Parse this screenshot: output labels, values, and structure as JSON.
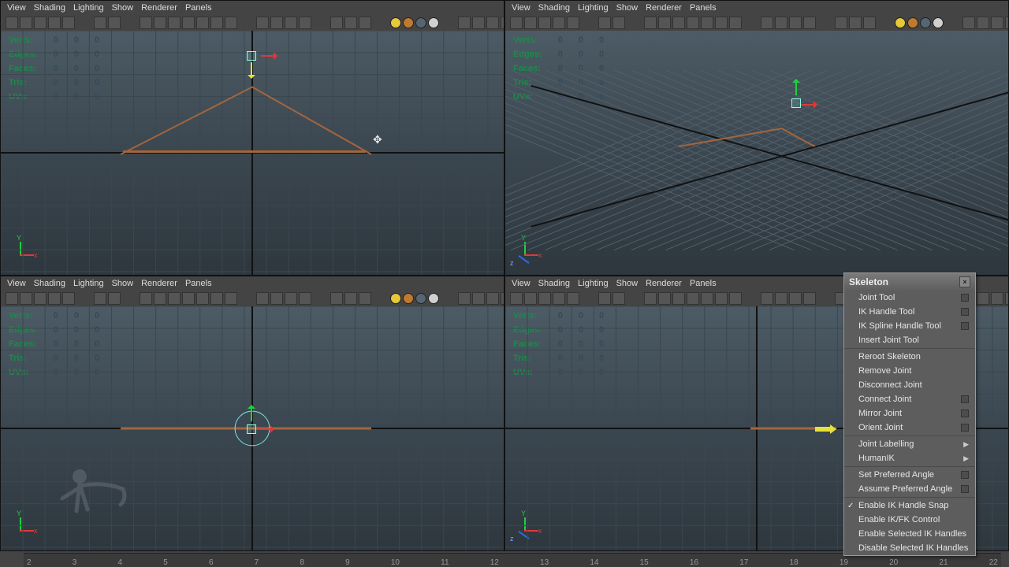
{
  "menus": [
    "View",
    "Shading",
    "Lighting",
    "Show",
    "Renderer",
    "Panels"
  ],
  "stats": {
    "labels": [
      "Verts:",
      "Edges:",
      "Faces:",
      "Tris:",
      "UVs:"
    ],
    "cols": [
      "0",
      "0",
      "0"
    ]
  },
  "skeleton": {
    "title": "Skeleton",
    "items": [
      {
        "label": "Joint Tool",
        "opt": true
      },
      {
        "label": "IK Handle Tool",
        "opt": true
      },
      {
        "label": "IK Spline Handle Tool",
        "opt": true
      },
      {
        "label": "Insert Joint Tool"
      },
      {
        "sep": true
      },
      {
        "label": "Reroot Skeleton"
      },
      {
        "label": "Remove Joint"
      },
      {
        "label": "Disconnect Joint"
      },
      {
        "label": "Connect Joint",
        "opt": true
      },
      {
        "label": "Mirror Joint",
        "opt": true
      },
      {
        "label": "Orient Joint",
        "opt": true
      },
      {
        "sep": true
      },
      {
        "label": "Joint Labelling",
        "submenu": true
      },
      {
        "label": "HumanIK",
        "submenu": true
      },
      {
        "sep": true
      },
      {
        "label": "Set Preferred Angle",
        "opt": true
      },
      {
        "label": "Assume Preferred Angle",
        "opt": true
      },
      {
        "sep": true
      },
      {
        "label": "Enable IK Handle Snap",
        "checked": true
      },
      {
        "label": "Enable IK/FK Control"
      },
      {
        "label": "Enable Selected IK Handles"
      },
      {
        "label": "Disable Selected IK Handles"
      }
    ]
  },
  "ruler": [
    "2",
    "3",
    "4",
    "5",
    "6",
    "7",
    "8",
    "9",
    "10",
    "11",
    "12",
    "13",
    "14",
    "15",
    "16",
    "17",
    "18",
    "19",
    "20",
    "21",
    "22"
  ],
  "toolbar_dots": [
    "#e6c93a",
    "#c07a30",
    "#556573",
    "#d0d0d0"
  ]
}
